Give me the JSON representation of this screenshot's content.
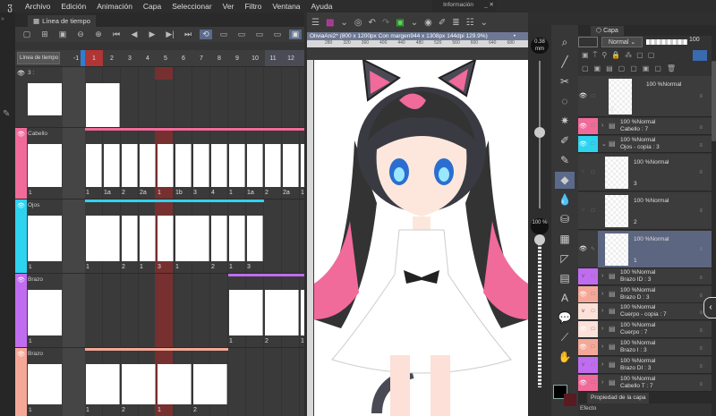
{
  "menu": {
    "logo": "clip-studio-logo",
    "items": [
      "Archivo",
      "Edición",
      "Animación",
      "Capa",
      "Seleccionar",
      "Ver",
      "Filtro",
      "Ventana",
      "Ayuda"
    ]
  },
  "info_window": {
    "title": "Información"
  },
  "timeline": {
    "tab": "Línea de tiempo",
    "selector": "Línea de tiempo",
    "frame_numbers": [
      "-1",
      "1",
      "2",
      "3",
      "4",
      "5",
      "6",
      "7",
      "8",
      "9",
      "10",
      "11",
      "12"
    ],
    "current_frame": 1,
    "tracks": [
      {
        "name": "3 :",
        "color": "#3a3a3a",
        "thumb_label": "",
        "bar_start": 0,
        "bar_len": 0,
        "cells": [
          {
            "start": 1,
            "span": 2,
            "label": ""
          }
        ]
      },
      {
        "name": "Cabello",
        "color": "#f06a9a",
        "thumb_label": "1",
        "bar_start": 1,
        "bar_len": 13,
        "cells": [
          {
            "start": 1,
            "span": 1,
            "label": "1"
          },
          {
            "start": 2,
            "span": 1,
            "label": "1a"
          },
          {
            "start": 3,
            "span": 1,
            "label": "2"
          },
          {
            "start": 4,
            "span": 1,
            "label": "2a"
          },
          {
            "start": 5,
            "span": 1,
            "label": "1"
          },
          {
            "start": 6,
            "span": 1,
            "label": "1b"
          },
          {
            "start": 7,
            "span": 1,
            "label": "3"
          },
          {
            "start": 8,
            "span": 1,
            "label": "4"
          },
          {
            "start": 9,
            "span": 1,
            "label": "1"
          },
          {
            "start": 10,
            "span": 1,
            "label": "1a"
          },
          {
            "start": 11,
            "span": 1,
            "label": "2"
          },
          {
            "start": 12,
            "span": 1,
            "label": "2a"
          },
          {
            "start": 13,
            "span": 1,
            "label": "1"
          }
        ]
      },
      {
        "name": "Ojos",
        "color": "#2ed3f0",
        "thumb_label": "1",
        "bar_start": 1,
        "bar_len": 10,
        "cells": [
          {
            "start": 1,
            "span": 2,
            "label": "1"
          },
          {
            "start": 3,
            "span": 1,
            "label": "2"
          },
          {
            "start": 4,
            "span": 1,
            "label": "1"
          },
          {
            "start": 5,
            "span": 1,
            "label": "3"
          },
          {
            "start": 6,
            "span": 2,
            "label": "1"
          },
          {
            "start": 8,
            "span": 1,
            "label": "2"
          },
          {
            "start": 9,
            "span": 1,
            "label": "1"
          },
          {
            "start": 10,
            "span": 1,
            "label": "3"
          }
        ]
      },
      {
        "name": "Brazo",
        "color": "#c06cf0",
        "thumb_label": "1",
        "bar_start": 9,
        "bar_len": 5,
        "cells": [
          {
            "start": 9,
            "span": 2,
            "label": "1"
          },
          {
            "start": 11,
            "span": 2,
            "label": "2"
          },
          {
            "start": 13,
            "span": 1,
            "label": "1"
          }
        ]
      },
      {
        "name": "Brazo",
        "color": "#f5a898",
        "thumb_label": "1",
        "bar_start": 1,
        "bar_len": 8,
        "cells": [
          {
            "start": 1,
            "span": 2,
            "label": "1"
          },
          {
            "start": 3,
            "span": 2,
            "label": "2"
          },
          {
            "start": 5,
            "span": 2,
            "label": "1"
          },
          {
            "start": 7,
            "span": 2,
            "label": "2"
          }
        ]
      }
    ]
  },
  "canvas": {
    "title": "OliviaAni2* (800 x 1200px Con margen944 x 1308px 144dpi 129.9%)",
    "ruler": [
      "280",
      "320",
      "360",
      "400",
      "440",
      "480",
      "520",
      "560",
      "600",
      "640",
      "680"
    ]
  },
  "brush": {
    "size": "0.38 mm",
    "opacity": "100 %",
    "size_fraction": 0.55,
    "opacity_fraction": 1.0,
    "main_color": "#000000",
    "sub_color": "#5a1a22"
  },
  "tools": [
    "zoom-icon",
    "line-icon",
    "transform-icon",
    "lasso-icon",
    "magic-wand-icon",
    "eyedropper-icon",
    "pen-icon",
    "eraser-icon",
    "blend-icon",
    "fill-icon",
    "frame-icon",
    "ruler-icon",
    "gradient-icon",
    "text-icon",
    "balloon-icon",
    "correction-icon",
    "hand-icon"
  ],
  "layers": {
    "tab": "Capa",
    "blend": "Normal",
    "opacity": "100",
    "rows": [
      {
        "type": "layer",
        "text": "100 %Normal",
        "sub": "3",
        "vis": "#3c3c3c",
        "chk": "#3c3c3c",
        "eye": true
      },
      {
        "type": "folder",
        "text": "100 %Normal",
        "sub": "Cabello : 7",
        "vis": "#f06a9a",
        "chk": "#f06a9a",
        "eye": true
      },
      {
        "type": "folder-open",
        "text": "100 %Normal",
        "sub": "Ojos - copia : 3",
        "vis": "#2ed3f0",
        "chk": "#2ed3f0",
        "eye": true
      },
      {
        "type": "child",
        "text": "100 %Normal",
        "sub": "3",
        "vis": "#3c3c3c",
        "chk": "#3c3c3c",
        "eye": false
      },
      {
        "type": "child",
        "text": "100 %Normal",
        "sub": "2",
        "vis": "#3c3c3c",
        "chk": "#3c3c3c",
        "eye": false
      },
      {
        "type": "child-selected",
        "text": "100 %Normal",
        "sub": "1",
        "vis": "#3c3c3c",
        "chk": "#3c3c3c",
        "eye": true
      },
      {
        "type": "folder",
        "text": "100 %Normal",
        "sub": "Brazo ID : 3",
        "vis": "#c06cf0",
        "chk": "#c06cf0",
        "eye": false
      },
      {
        "type": "folder",
        "text": "100 %Normal",
        "sub": "Brazo D : 3",
        "vis": "#f5a898",
        "chk": "#f5a898",
        "eye": true
      },
      {
        "type": "folder",
        "text": "100 %Normal",
        "sub": "Cuerpo - copia : 7",
        "vis": "#fde0d8",
        "chk": "#fde0d8",
        "eye": false
      },
      {
        "type": "folder",
        "text": "100 %Normal",
        "sub": "Cuerpo : 7",
        "vis": "#fde0d8",
        "chk": "#fde0d8",
        "eye": true
      },
      {
        "type": "folder",
        "text": "100 %Normal",
        "sub": "Brazo I : 3",
        "vis": "#f5a898",
        "chk": "#f5a898",
        "eye": true
      },
      {
        "type": "folder",
        "text": "100 %Normal",
        "sub": "Brazo DI : 3",
        "vis": "#c06cf0",
        "chk": "#c06cf0",
        "eye": false
      },
      {
        "type": "folder",
        "text": "100 %Normal",
        "sub": "Cabello T : 7",
        "vis": "#f06a9a",
        "chk": "#f06a9a",
        "eye": true
      }
    ],
    "property_tab": "Propiedad de la capa",
    "effect_label": "Efecto"
  }
}
